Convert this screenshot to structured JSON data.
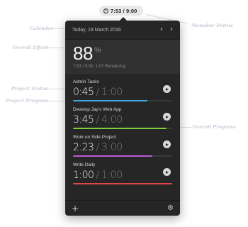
{
  "menubar": {
    "icon": "clock-icon",
    "text": "7:53 / 9:00"
  },
  "header": {
    "date": "Today, 18 March 2016",
    "prev_icon": "chevron-left-icon",
    "next_icon": "chevron-right-icon"
  },
  "overall": {
    "percent": "88",
    "percent_sign": "%",
    "remaining": "7:53 / 9:00. 1:07 Remaining."
  },
  "projects": [
    {
      "name": "Admin Tasks",
      "spent": "0:45",
      "slash": "/",
      "goal": "1:00",
      "progress": 0.75,
      "color": "#3fa9e0"
    },
    {
      "name": "Develop Jay's Web App",
      "spent": "3:45",
      "slash": "/",
      "goal": "4:00",
      "progress": 0.94,
      "color": "#7fd13b"
    },
    {
      "name": "Work on Side Project",
      "spent": "2:23",
      "slash": "/",
      "goal": "3:00",
      "progress": 0.8,
      "color": "#b85ad6"
    },
    {
      "name": "Write Daily",
      "spent": "1:00",
      "slash": "/",
      "goal": "1:00",
      "progress": 1.0,
      "color": "#e0454e"
    }
  ],
  "footer": {
    "add_icon": "plus-icon",
    "settings_icon": "gear-icon"
  },
  "annotations": {
    "calendar": "Calendar",
    "overall_effort": "Overall Effort",
    "project_status": "Project Status",
    "project_progress": "Project Progress",
    "menubar_status": "Menubar Status",
    "overall_progress": "Overall Progress"
  }
}
